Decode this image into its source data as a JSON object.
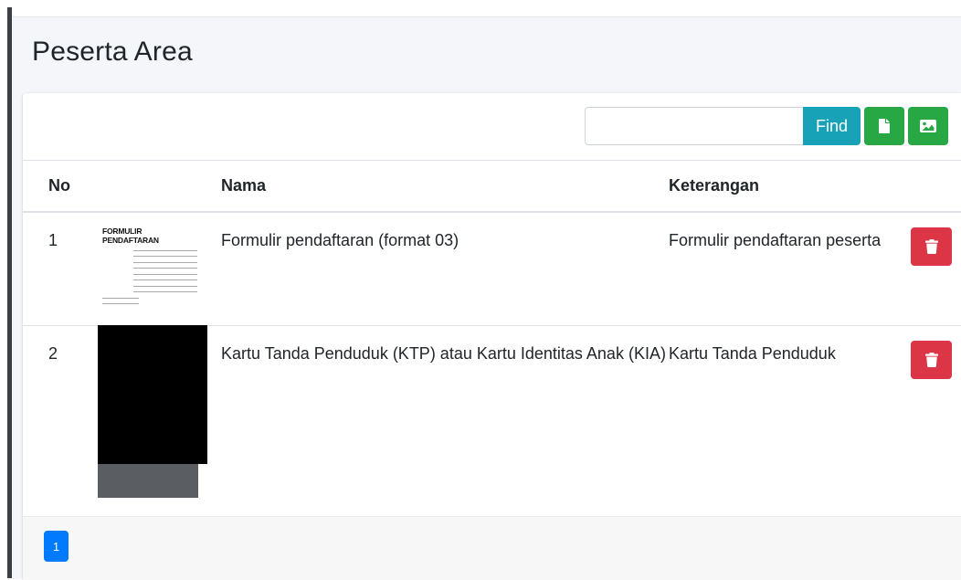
{
  "page": {
    "title": "Peserta Area"
  },
  "toolbar": {
    "search_placeholder": "",
    "search_value": "",
    "find_label": "Find",
    "file_icon": "file-icon",
    "image_icon": "image-icon"
  },
  "table": {
    "headers": {
      "no": "No",
      "thumb": "",
      "nama": "Nama",
      "keterangan": "Keterangan"
    },
    "rows": [
      {
        "no": "1",
        "nama": "Formulir pendaftaran (format 03)",
        "keterangan": "Formulir pendaftaran peserta",
        "thumbnail_title": "FORMULIR PENDAFTARAN"
      },
      {
        "no": "2",
        "nama": "Kartu Tanda Penduduk (KTP) atau Kartu Identitas Anak (KIA)",
        "keterangan": "Kartu Tanda Penduduk"
      }
    ],
    "delete_icon": "trash-icon"
  },
  "pagination": {
    "current": "1"
  },
  "colors": {
    "find": "#17a2b8",
    "green": "#28a745",
    "delete": "#dc3545",
    "page": "#007bff",
    "background": "#f4f6f9"
  }
}
